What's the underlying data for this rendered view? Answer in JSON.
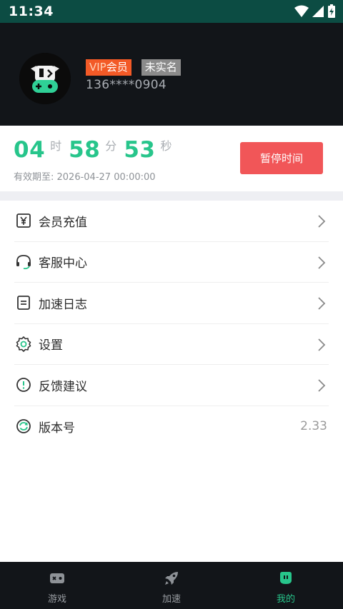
{
  "status_bar": {
    "time": "11:34"
  },
  "profile": {
    "vip_prefix": "VIP",
    "vip_suffix": "会员",
    "unverified_label": "未实名",
    "phone": "136****0904"
  },
  "timer": {
    "hours": "04",
    "hours_unit": "时",
    "minutes": "58",
    "minutes_unit": "分",
    "seconds": "53",
    "seconds_unit": "秒",
    "expiry": "有效期至: 2026-04-27 00:00:00",
    "pause_label": "暂停时间"
  },
  "menu": [
    {
      "label": "会员充值",
      "icon": "yuan-icon"
    },
    {
      "label": "客服中心",
      "icon": "headset-icon"
    },
    {
      "label": "加速日志",
      "icon": "log-icon"
    },
    {
      "label": "设置",
      "icon": "gear-icon"
    },
    {
      "label": "反馈建议",
      "icon": "feedback-icon"
    },
    {
      "label": "版本号",
      "icon": "refresh-icon",
      "value": "2.33"
    }
  ],
  "bottom_nav": [
    {
      "label": "游戏",
      "icon": "gamepad-icon"
    },
    {
      "label": "加速",
      "icon": "rocket-icon"
    },
    {
      "label": "我的",
      "icon": "mascot-icon",
      "active": true
    }
  ],
  "colors": {
    "accent": "#27c58b",
    "pause_button": "#f15658",
    "vip_badge": "#f35a27",
    "header_bg": "#121519",
    "status_bar": "#0c4c43"
  }
}
